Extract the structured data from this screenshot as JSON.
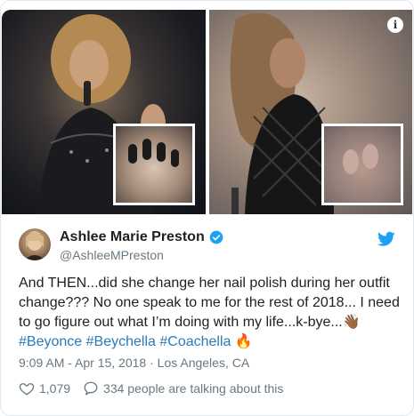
{
  "tweet": {
    "author_name": "Ashlee Marie Preston",
    "author_handle": "@AshleeMPreston",
    "text_parts": [
      "And THEN...did she change her nail polish during her outfit change??? No one speak to me for the rest of 2018... I need to go figure out what I’m doing with my life...k-bye...",
      "👋🏾",
      "#Beyonce",
      "#Beychella",
      "#Coachella",
      "🔥"
    ],
    "time": "9:09 AM - Apr 15, 2018",
    "separator": "·",
    "location": "Los Angeles, CA",
    "likes": "1,079",
    "talking": "334 people are talking about this"
  },
  "info_icon_glyph": "i",
  "colors": {
    "link": "#2b7bb9",
    "twitter_blue": "#1da1f2",
    "meta_gray": "#697882",
    "text": "#1c2022"
  }
}
